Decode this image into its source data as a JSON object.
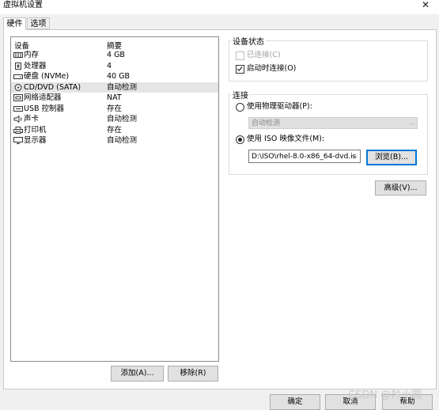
{
  "window": {
    "title": "虚拟机设置",
    "close_glyph": "✕"
  },
  "tabs": [
    {
      "label": "硬件"
    },
    {
      "label": "选项"
    }
  ],
  "device_list": {
    "header_device": "设备",
    "header_summary": "摘要",
    "items": [
      {
        "name": "内存",
        "summary": "4 GB",
        "icon": "memory-icon"
      },
      {
        "name": "处理器",
        "summary": "4",
        "icon": "cpu-icon"
      },
      {
        "name": "硬盘 (NVMe)",
        "summary": "40 GB",
        "icon": "hard-disk-icon"
      },
      {
        "name": "CD/DVD (SATA)",
        "summary": "自动检测",
        "icon": "cd-dvd-icon",
        "selected": true
      },
      {
        "name": "网络适配器",
        "summary": "NAT",
        "icon": "network-adapter-icon"
      },
      {
        "name": "USB 控制器",
        "summary": "存在",
        "icon": "usb-icon"
      },
      {
        "name": "声卡",
        "summary": "自动检测",
        "icon": "sound-card-icon"
      },
      {
        "name": "打印机",
        "summary": "存在",
        "icon": "printer-icon"
      },
      {
        "name": "显示器",
        "summary": "自动检测",
        "icon": "display-icon"
      }
    ],
    "add_button": "添加(A)...",
    "remove_button": "移除(R)"
  },
  "device_status": {
    "title": "设备状态",
    "connected_label": "已连接(C)",
    "connected_checked": false,
    "connected_disabled": true,
    "connect_at_power_on_label": "启动时连接(O)",
    "connect_at_power_on_checked": true
  },
  "connection": {
    "title": "连接",
    "physical_drive_label": "使用物理驱动器(P):",
    "physical_drive_value": "自动检测",
    "iso_label": "使用 ISO 映像文件(M):",
    "iso_path": "D:\\ISO\\rhel-8.0-x86_64-dvd.is",
    "browse_button": "浏览(B)...",
    "selected": "iso"
  },
  "advanced_button": "高级(V)...",
  "footer": {
    "ok_button": "确定",
    "cancel_button": "取消",
    "help_button": "帮助",
    "watermark": "CSDN @羚小圆"
  }
}
